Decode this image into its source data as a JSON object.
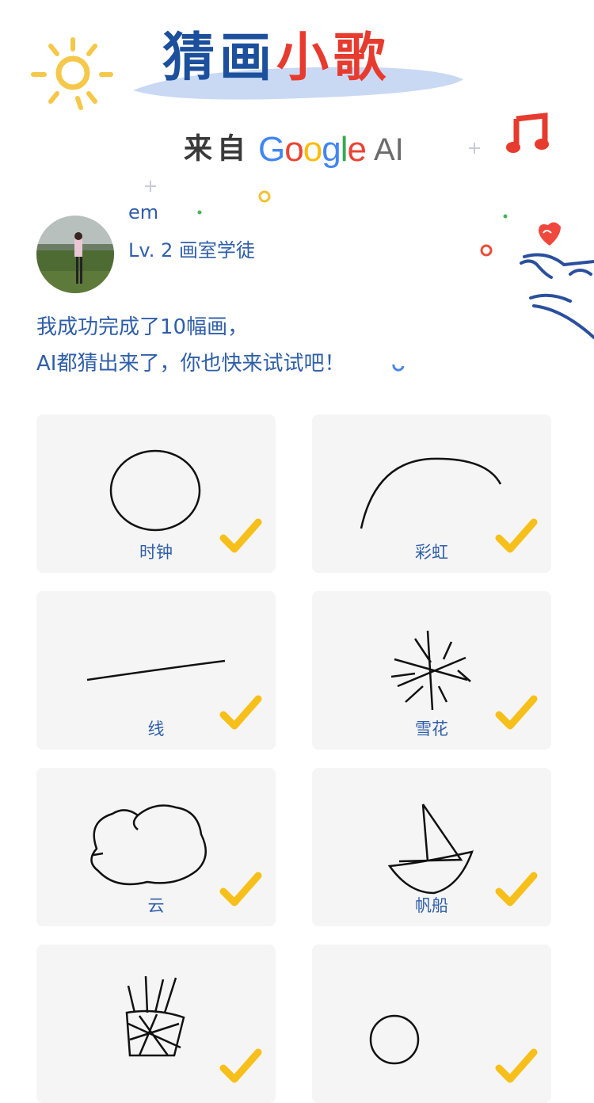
{
  "header": {
    "title_part1": "猜画",
    "title_part2": "小歌",
    "from_label": "来自",
    "google_letters": [
      {
        "ch": "G",
        "color": "#4285f4"
      },
      {
        "ch": "o",
        "color": "#ea4335"
      },
      {
        "ch": "o",
        "color": "#fbbc05"
      },
      {
        "ch": "g",
        "color": "#4285f4"
      },
      {
        "ch": "l",
        "color": "#34a853"
      },
      {
        "ch": "e",
        "color": "#ea4335"
      }
    ],
    "ai_label": "AI"
  },
  "user": {
    "name": "em",
    "level": "Lv. 2 画室学徒"
  },
  "message": {
    "line1": "我成功完成了10幅画，",
    "line2": "AI都猜出来了，你也快来试试吧！"
  },
  "drawings": [
    {
      "label": "时钟",
      "icon": "clock-doodle",
      "guessed": true
    },
    {
      "label": "彩虹",
      "icon": "rainbow-doodle",
      "guessed": true
    },
    {
      "label": "线",
      "icon": "line-doodle",
      "guessed": true
    },
    {
      "label": "雪花",
      "icon": "snowflake-doodle",
      "guessed": true
    },
    {
      "label": "云",
      "icon": "cloud-doodle",
      "guessed": true
    },
    {
      "label": "帆船",
      "icon": "sailboat-doodle",
      "guessed": true
    },
    {
      "label": "",
      "icon": "basket-doodle",
      "guessed": true
    },
    {
      "label": "",
      "icon": "bicycle-doodle",
      "guessed": true
    }
  ],
  "colors": {
    "brand_blue": "#1c4f9c",
    "brand_red": "#e63b2e",
    "text_blue": "#2f5ea8",
    "check_yellow": "#f7bf1a",
    "card_bg": "#f5f5f5"
  }
}
